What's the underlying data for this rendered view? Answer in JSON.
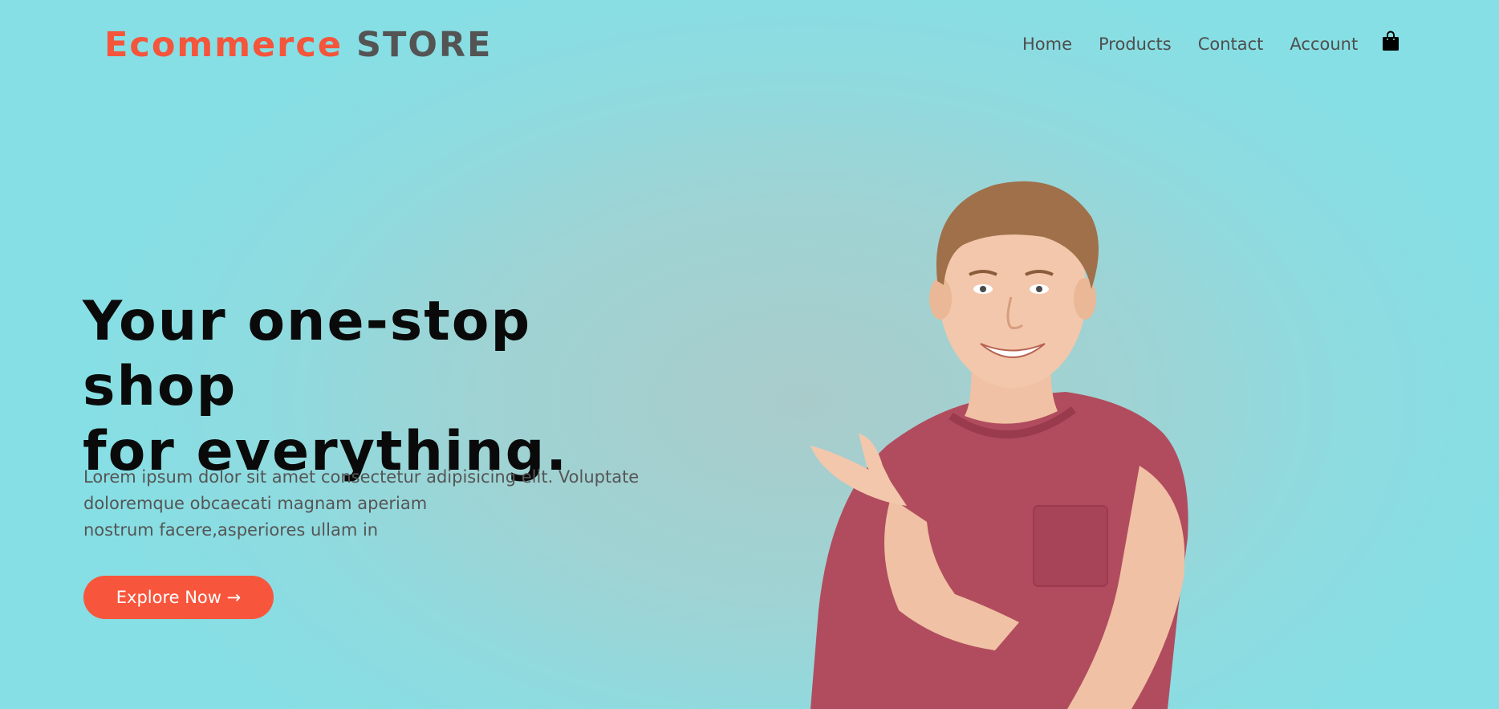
{
  "header": {
    "logo_brand": "Ecommerce",
    "logo_suffix": "STORE",
    "nav": [
      {
        "label": "Home"
      },
      {
        "label": "Products"
      },
      {
        "label": "Contact"
      },
      {
        "label": "Account"
      }
    ],
    "cart_icon": "shopping-bag-icon"
  },
  "hero": {
    "title_line1": "Your one-stop shop",
    "title_line2": "for everything.",
    "text_line1": "Lorem ipsum dolor sit amet consectetur adipisicing elit. Voluptate",
    "text_line2": "doloremque obcaecati magnam aperiam",
    "text_line3": "nostrum facere,asperiores ullam in",
    "cta_label": "Explore Now →"
  },
  "colors": {
    "accent": "#f4553b",
    "logo_secondary": "#545454",
    "background": "#8edbe0",
    "title": "#0a0a0a",
    "body_text": "#555555"
  }
}
